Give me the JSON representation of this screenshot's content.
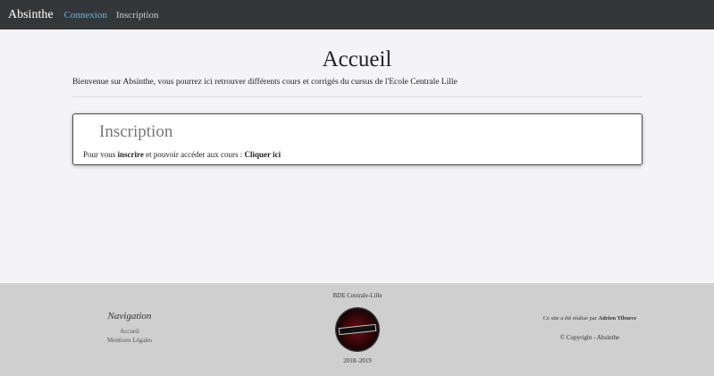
{
  "navbar": {
    "brand": "Absinthe",
    "links": [
      {
        "label": "Connexion"
      },
      {
        "label": "Inscription"
      }
    ]
  },
  "main": {
    "title": "Accueil",
    "intro": "Bienvenue sur Absinthe, vous pourrez ici retrouver différents cours et corrigés du cursus de l'Ecole Centrale Lille",
    "card": {
      "title": "Inscription",
      "text_before": "Pour vous ",
      "text_bold": "inscrire",
      "text_after": " et pouvoir accéder aux cours : ",
      "link_label": "Cliquer ici"
    }
  },
  "footer": {
    "navigation_heading": "Navigation",
    "navigation_links": [
      "Accueil",
      "Mentions Légales"
    ],
    "bde_title": "BDE Centrale-Lille",
    "year": "2018–2019",
    "credit_prefix": "Ce site a été réalisé par ",
    "credit_name": "Adrien Tiburce",
    "copyright": "© Copyright - Absinthe"
  },
  "colors": {
    "navbar_bg": "#34373a",
    "active_link": "#6bb6d6",
    "page_bg": "#f4f4f7",
    "footer_bg": "#cfcfcf"
  }
}
